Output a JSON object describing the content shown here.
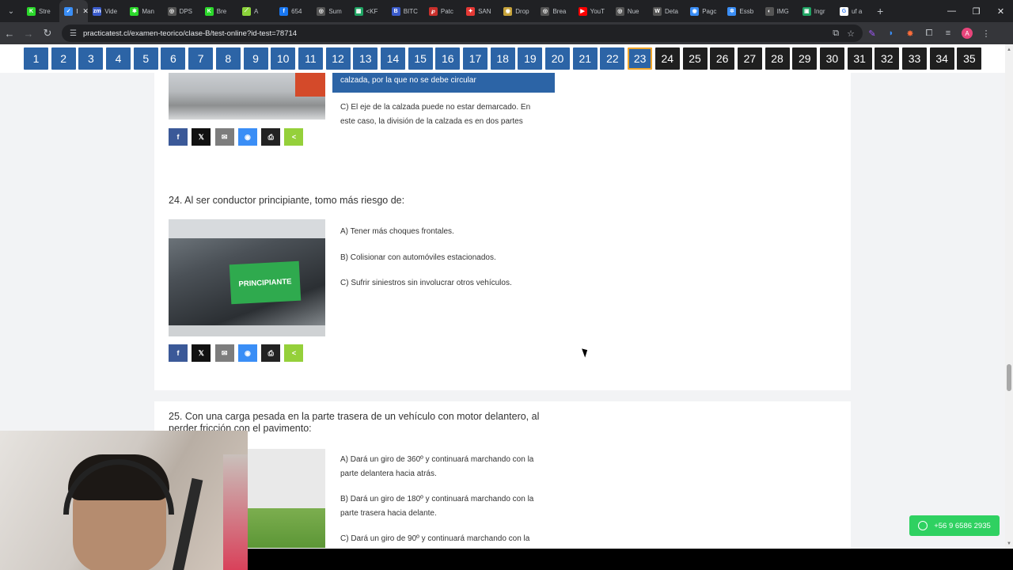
{
  "tabs": [
    {
      "label": "Stre",
      "color": "#2bd82b",
      "glyph": "K"
    },
    {
      "label": "I",
      "color": "#3a8ef6",
      "glyph": "✓",
      "active": true
    },
    {
      "label": "Vide",
      "color": "#3b5ccc",
      "glyph": "zm"
    },
    {
      "label": "Man",
      "color": "#2bd82b",
      "glyph": "✱"
    },
    {
      "label": "DPS",
      "color": "#555555",
      "glyph": "◎"
    },
    {
      "label": "Bre",
      "color": "#2bd82b",
      "glyph": "K"
    },
    {
      "label": "A",
      "color": "#8bd23a",
      "glyph": "⟋"
    },
    {
      "label": "654",
      "color": "#1877f2",
      "glyph": "f"
    },
    {
      "label": "Sum",
      "color": "#555555",
      "glyph": "◎"
    },
    {
      "label": "<KF",
      "color": "#1fa463",
      "glyph": "▦"
    },
    {
      "label": "BITC",
      "color": "#3b5ccc",
      "glyph": "B"
    },
    {
      "label": "Patc",
      "color": "#c9302c",
      "glyph": "℘"
    },
    {
      "label": "SAN",
      "color": "#e53935",
      "glyph": "✦"
    },
    {
      "label": "Drop",
      "color": "#c7a33a",
      "glyph": "◉"
    },
    {
      "label": "Brea",
      "color": "#555555",
      "glyph": "◎"
    },
    {
      "label": "YouT",
      "color": "#ff0000",
      "glyph": "▶"
    },
    {
      "label": "Nue",
      "color": "#555555",
      "glyph": "◎"
    },
    {
      "label": "Deta",
      "color": "#555555",
      "glyph": "W"
    },
    {
      "label": "Pagc",
      "color": "#3a8ef6",
      "glyph": "◉"
    },
    {
      "label": "Essb",
      "color": "#3a8ef6",
      "glyph": "✲"
    },
    {
      "label": "IMG",
      "color": "#555555",
      "glyph": "◐"
    },
    {
      "label": "Ingr",
      "color": "#1fa463",
      "glyph": "▣"
    },
    {
      "label": "uf a",
      "color": "#ffffff",
      "glyph": "G"
    }
  ],
  "address": {
    "url": "practicatest.cl/examen-teorico/clase-B/test-online?id-test=78714"
  },
  "question_nav": {
    "current": 23,
    "buttons": [
      "1",
      "2",
      "3",
      "4",
      "5",
      "6",
      "7",
      "8",
      "9",
      "10",
      "11",
      "12",
      "13",
      "14",
      "15",
      "16",
      "17",
      "18",
      "19",
      "20",
      "21",
      "22",
      "23",
      "24",
      "25",
      "26",
      "27",
      "28",
      "29",
      "30",
      "31",
      "32",
      "33",
      "34",
      "35"
    ]
  },
  "q23": {
    "selected_answer": "calzada, por la que no se debe circular",
    "answer_c": "C) El eje de la calzada puede no estar demarcado. En este caso, la división de la calzada es en dos partes"
  },
  "q24": {
    "title": "24. Al ser conductor principiante, tomo más riesgo de:",
    "sticker_text": "PRINCIPIANTE",
    "answers": [
      "A) Tener más choques frontales.",
      "B) Colisionar con automóviles estacionados.",
      "C) Sufrir siniestros sin involucrar otros vehículos."
    ]
  },
  "q25": {
    "title": "25. Con una carga pesada en la parte trasera de un vehículo con motor delantero, al perder fricción con el pavimento:",
    "answers": [
      "A) Dará un giro de 360º y continuará marchando con la parte delantera hacia atrás.",
      "B) Dará un giro de 180º y continuará marchando con la parte trasera hacia delante.",
      "C) Dará un giro de 90º y continuará marchando con la"
    ]
  },
  "share_icons": {
    "facebook": "f",
    "twitter": "𝕏",
    "email": "✉",
    "messenger": "◉",
    "print": "⎙",
    "share": "<"
  },
  "whatsapp": {
    "label": "+56 9 6586 2935"
  }
}
